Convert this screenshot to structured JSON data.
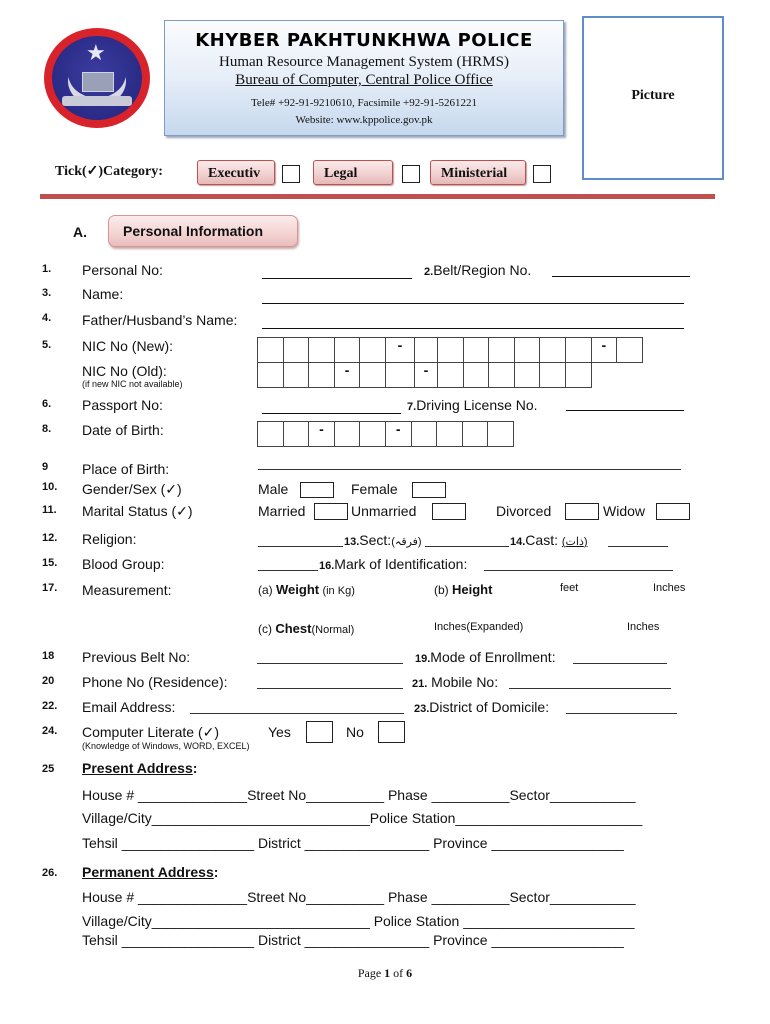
{
  "header": {
    "logo": "kp-police-emblem",
    "title": "KHYBER PAKHTUNKHWA POLICE",
    "subtitle": "Human Resource Management System (HRMS)",
    "bureau": "Bureau of Computer, Central Police Office",
    "contact": "Tele# +92-91-9210610, Facsimile +92-91-5261221",
    "website": "Website: www.kppolice.gov.pk",
    "picture_label": "Picture"
  },
  "category": {
    "label_prefix": "Tick(",
    "tick": "✓",
    "label_suffix": ")Category:",
    "options": [
      "Executiv",
      "Legal",
      "Ministerial"
    ]
  },
  "section_a": {
    "letter": "A.",
    "title": "Personal Information"
  },
  "fields": {
    "personal_no": {
      "num": "1.",
      "label": "Personal No:"
    },
    "belt_region": {
      "num": "2.",
      "label": "Belt/Region No."
    },
    "name": {
      "num": "3.",
      "label": "Name:"
    },
    "father_name": {
      "num": "4.",
      "label": "Father/Husband’s Name:"
    },
    "nic_new": {
      "num": "5.",
      "label": "NIC No (New):"
    },
    "nic_old": {
      "label": "NIC No (Old):",
      "note": "(if new NIC not available)"
    },
    "passport": {
      "num": "6.",
      "label": "Passport No:"
    },
    "driving": {
      "num": "7.",
      "label": "Driving License No."
    },
    "dob": {
      "num": "8.",
      "label": "Date of Birth:"
    },
    "birth_place": {
      "num": "9",
      "label": "Place of Birth:"
    },
    "gender": {
      "num": "10.",
      "label": "Gender/Sex (✓)",
      "options": [
        "Male",
        "Female"
      ]
    },
    "marital": {
      "num": "11.",
      "label": "Marital Status (✓)",
      "options": [
        "Married",
        "Unmarried",
        "Divorced",
        "Widow"
      ]
    },
    "religion": {
      "num": "12.",
      "label": "Religion:"
    },
    "sect": {
      "num": "13.",
      "label": "Sect:",
      "urdu": "(فرقہ)"
    },
    "cast": {
      "num": "14.",
      "label": "Cast:",
      "urdu": "(ذات)"
    },
    "blood_group": {
      "num": "15.",
      "label": "Blood Group:"
    },
    "mark_id": {
      "num": "16.",
      "label": "Mark of Identification:"
    },
    "measurement": {
      "num": "17.",
      "label": "Measurement:",
      "weight_prefix": "(a)",
      "weight": "Weight",
      "weight_unit": "(in Kg)",
      "height_prefix": "(b)",
      "height": "Height",
      "feet": "feet",
      "inches": "Inches",
      "chest_prefix": "(c)",
      "chest": "Chest",
      "chest_normal": "(Normal)",
      "chest_expanded": "Inches(Expanded)",
      "chest_inches": "Inches"
    },
    "prev_belt": {
      "num": "18",
      "label": "Previous Belt No:"
    },
    "enrollment": {
      "num": "19.",
      "label": "Mode of Enrollment:"
    },
    "phone": {
      "num": "20",
      "label": "Phone No (Residence):"
    },
    "mobile": {
      "num": "21.",
      "label": " Mobile No:"
    },
    "email": {
      "num": "22.",
      "label": "Email Address:"
    },
    "domicile": {
      "num": "23.",
      "label": "District of Domicile:"
    },
    "computer": {
      "num": "24.",
      "label": "Computer Literate (✓)",
      "note": "(Knowledge of Windows, WORD, EXCEL)",
      "options": [
        "Yes",
        "No"
      ]
    }
  },
  "present_address": {
    "num": "25",
    "title": "Present Address",
    "row1": {
      "house": "House #",
      "street": "Street No",
      "phase": "Phase",
      "sector": "Sector"
    },
    "row2": {
      "village": "Village/City",
      "police": "Police Station"
    },
    "row3": {
      "tehsil": "Tehsil",
      "district": "District",
      "province": "Province"
    }
  },
  "permanent_address": {
    "num": "26.",
    "title": "Permanent Address",
    "row1": {
      "house": "House #",
      "street": "Street No",
      "phase": "Phase",
      "sector": "Sector"
    },
    "row2": {
      "village": "Village/City",
      "police": "Police Station"
    },
    "row3": {
      "tehsil": "Tehsil",
      "district": "District",
      "province": "Province"
    }
  },
  "footer": {
    "page_word": "Page",
    "current": "1",
    "of_word": "of",
    "total": "6"
  },
  "colors": {
    "accent_red": "#c0504d",
    "picture_border": "#5f8ccb",
    "header_blue": "#c6d8ee"
  }
}
